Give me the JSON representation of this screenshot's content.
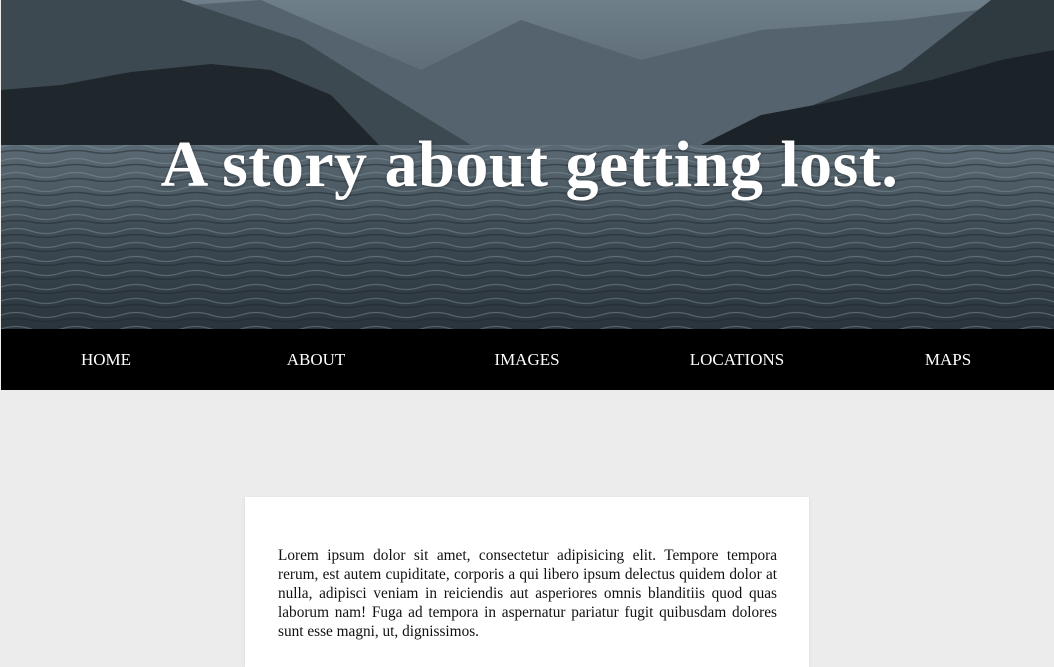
{
  "hero": {
    "title": "A story about getting lost."
  },
  "nav": {
    "items": [
      {
        "label": "HOME"
      },
      {
        "label": "ABOUT"
      },
      {
        "label": "IMAGES"
      },
      {
        "label": "LOCATIONS"
      },
      {
        "label": "MAPS"
      }
    ]
  },
  "content": {
    "paragraph": "Lorem ipsum dolor sit amet, consectetur adipisicing elit. Tempore tempora rerum, est autem cupiditate, corporis a qui libero ipsum delectus quidem dolor at nulla, adipisci veniam in reiciendis aut asperiores omnis blanditiis quod quas laborum nam! Fuga ad tempora in aspernatur pariatur fugit quibusdam dolores sunt esse magni, ut, dignissimos."
  },
  "colors": {
    "nav_background": "#000000",
    "page_background": "#ececec",
    "card_background": "#ffffff"
  }
}
